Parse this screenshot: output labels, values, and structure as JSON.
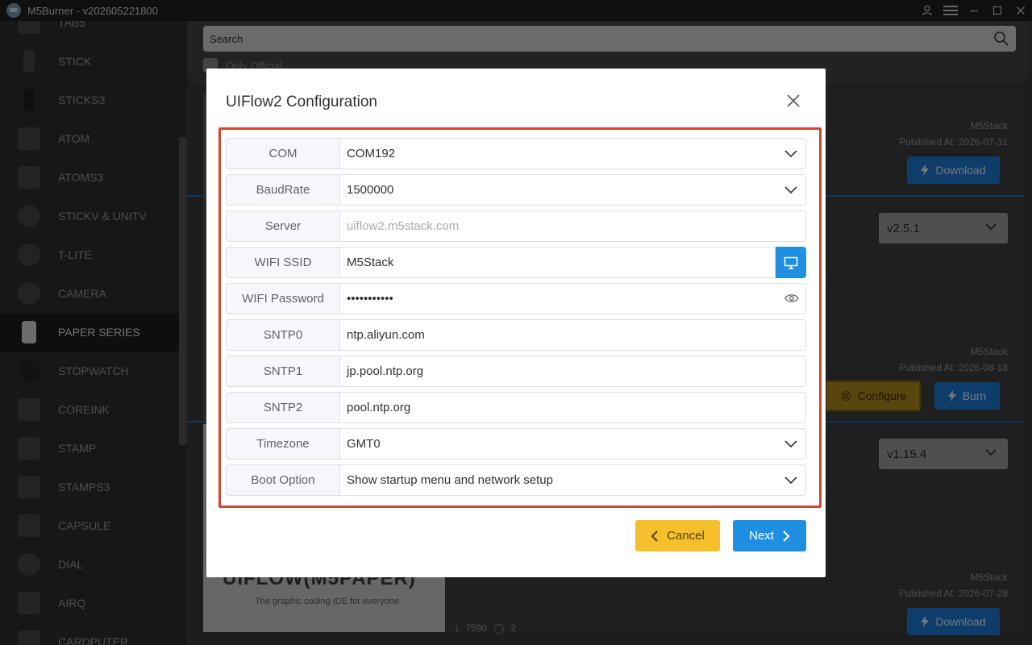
{
  "app": {
    "title": "M5Burner - v202605221800"
  },
  "sidebar": {
    "items": [
      {
        "label": "TAB5"
      },
      {
        "label": "STICK"
      },
      {
        "label": "STICKS3"
      },
      {
        "label": "ATOM"
      },
      {
        "label": "ATOMS3"
      },
      {
        "label": "STICKV & UNITV"
      },
      {
        "label": "T-LITE"
      },
      {
        "label": "CAMERA"
      },
      {
        "label": "PAPER SERIES"
      },
      {
        "label": "STOPWATCH"
      },
      {
        "label": "COREINK"
      },
      {
        "label": "STAMP"
      },
      {
        "label": "STAMPS3"
      },
      {
        "label": "CAPSULE"
      },
      {
        "label": "DIAL"
      },
      {
        "label": "AIRQ"
      },
      {
        "label": "CARDPUTER"
      }
    ],
    "active": "PAPER SERIES"
  },
  "search": {
    "placeholder": "Search",
    "only_official": "Only Official"
  },
  "cards": [
    {
      "author": "M5Stack",
      "published": "Published At: 2026-07-31",
      "button": "Download"
    },
    {
      "version": "v2.5.1",
      "author": "M5Stack",
      "published": "Published At: 2026-08-18",
      "configure": "Configure",
      "burn": "Burn"
    },
    {
      "version": "v1.15.4",
      "author": "M5Stack",
      "published": "Published At: 2026-07-28",
      "button": "Download",
      "image_title": "UIFLOW(M5PAPER)",
      "image_subtitle": "The graphic coding IDE for everyone",
      "downloads": "7590",
      "comments": "2"
    }
  ],
  "dialog": {
    "title": "UIFlow2 Configuration",
    "rows": [
      {
        "label": "COM",
        "value": "COM192"
      },
      {
        "label": "BaudRate",
        "value": "1500000"
      },
      {
        "label": "Server",
        "placeholder": "uiflow2.m5stack.com"
      },
      {
        "label": "WIFI SSID",
        "value": "M5Stack"
      },
      {
        "label": "WIFI Password",
        "value": "•••••••••••"
      },
      {
        "label": "SNTP0",
        "value": "ntp.aliyun.com"
      },
      {
        "label": "SNTP1",
        "value": "jp.pool.ntp.org"
      },
      {
        "label": "SNTP2",
        "value": "pool.ntp.org"
      },
      {
        "label": "Timezone",
        "value": "GMT0"
      },
      {
        "label": "Boot Option",
        "value": "Show startup menu and network setup"
      }
    ],
    "cancel": "Cancel",
    "next": "Next"
  },
  "colors": {
    "accent": "#1e8fe1",
    "frame": "#cc4a32",
    "cancel": "#f6c02c"
  }
}
